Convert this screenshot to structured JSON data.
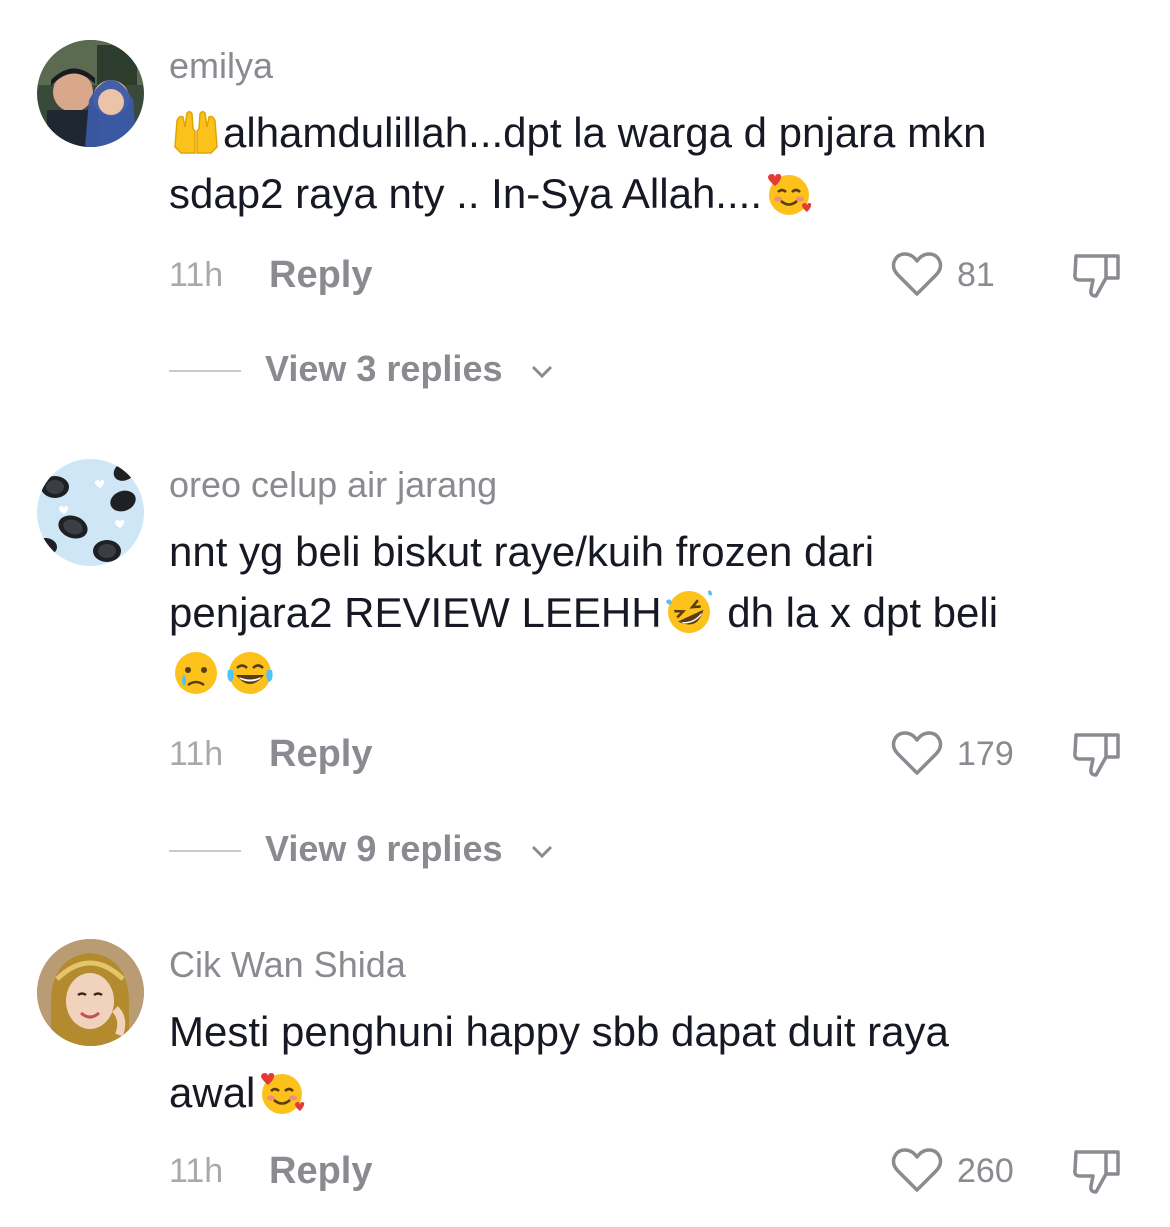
{
  "comments": [
    {
      "username": "emilya",
      "text_line1_after_emoji": "alhamdulillah...dpt la warga d pnjara mkn",
      "text_line2": "sdap2 raya nty .. In-Sya Allah....",
      "emojis": [
        "raising-hands-emoji",
        "smiling-face-with-hearts-emoji"
      ],
      "time": "11h",
      "reply_label": "Reply",
      "likes": "81",
      "view_replies_label": "View 3 replies"
    },
    {
      "username": "oreo celup air jarang",
      "text_line1": "nnt yg beli biskut raye/kuih frozen dari",
      "text_line2_before_emoji": "penjara2 REVIEW LEEHH",
      "text_line2_after_emoji": " dh la x dpt beli",
      "emojis": [
        "rolling-on-floor-laughing-emoji",
        "crying-face-emoji",
        "tears-of-joy-emoji"
      ],
      "time": "11h",
      "reply_label": "Reply",
      "likes": "179",
      "view_replies_label": "View 9 replies"
    },
    {
      "username": "Cik Wan Shida",
      "text_line1": "Mesti penghuni happy sbb dapat duit raya",
      "text_line2": "awal",
      "emojis": [
        "smiling-face-with-hearts-emoji"
      ],
      "time": "11h",
      "reply_label": "Reply",
      "likes": "260"
    }
  ],
  "colors": {
    "primary_text": "#161823",
    "secondary_text": "#8a8b91",
    "tertiary_text": "#a8a9ad"
  }
}
